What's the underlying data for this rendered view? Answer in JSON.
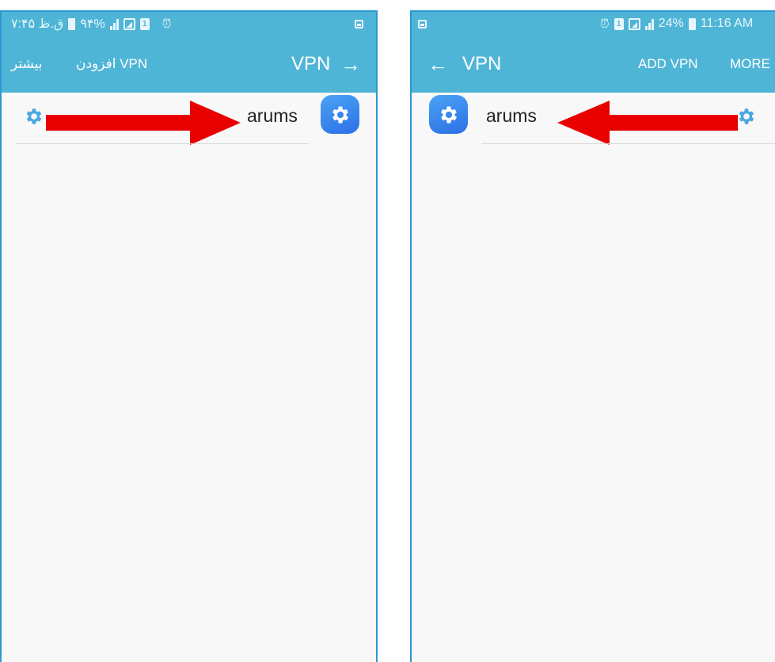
{
  "left_screen": {
    "status": {
      "time": "۷:۴۵ ق.ظ",
      "battery_percent": "۹۴%"
    },
    "appbar": {
      "more_label": "بیشتر",
      "add_vpn_label": "افزودن VPN",
      "title": "VPN",
      "nav_arrow": "→"
    },
    "vpn_list": [
      {
        "name": "arums"
      }
    ]
  },
  "right_screen": {
    "status": {
      "battery_percent": "24%",
      "time": "11:16 AM"
    },
    "appbar": {
      "nav_arrow": "←",
      "title": "VPN",
      "add_vpn_label": "ADD VPN",
      "more_label": "MORE"
    },
    "vpn_list": [
      {
        "name": "arums"
      }
    ]
  },
  "icons": {
    "settings": "gear-icon",
    "app": "settings-app-icon",
    "annotation": "red-arrow"
  },
  "colors": {
    "bar": "#4fb5d6",
    "border": "#2e97d3",
    "gear_accent": "#4aa8e0",
    "app_icon": "#3a86ee",
    "arrow": "#e80000",
    "background": "#f8f8f8"
  }
}
